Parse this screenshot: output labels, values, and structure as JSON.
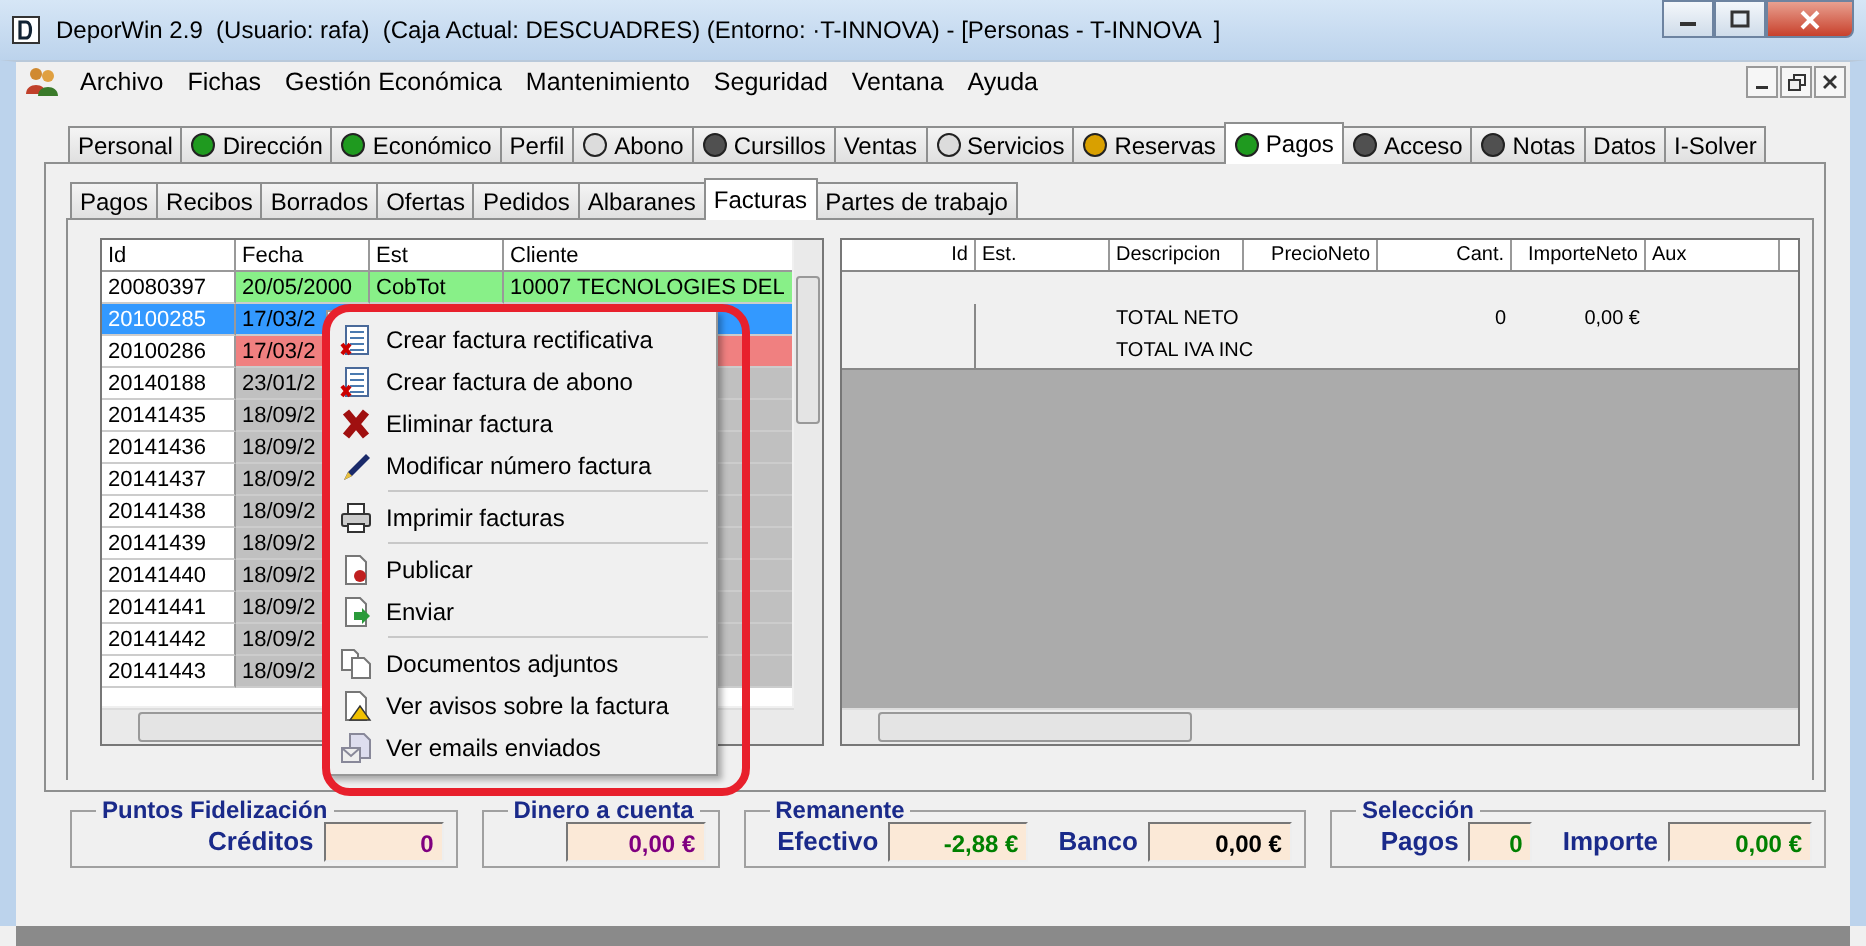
{
  "window": {
    "title": "DeporWin 2.9  (Usuario: rafa)  (Caja Actual: DESCUADRES) (Entorno: ·T-INNOVA) - [Personas - T-INNOVA  ]"
  },
  "menu_bar": [
    "Archivo",
    "Fichas",
    "Gestión Económica",
    "Mantenimiento",
    "Seguridad",
    "Ventana",
    "Ayuda"
  ],
  "main_tabs": [
    {
      "label": "Personal",
      "selected": false
    },
    {
      "label": "Dirección",
      "selected": false,
      "color": "#1f9a1f"
    },
    {
      "label": "Económico",
      "selected": false,
      "color": "#1f9a1f"
    },
    {
      "label": "Perfil",
      "selected": false
    },
    {
      "label": "Abono",
      "selected": false,
      "color": "#dcdcdc"
    },
    {
      "label": "Cursillos",
      "selected": false,
      "color": "#505050"
    },
    {
      "label": "Ventas",
      "selected": false
    },
    {
      "label": "Servicios",
      "selected": false,
      "color": "#dcdcdc"
    },
    {
      "label": "Reservas",
      "selected": false,
      "color": "#d9a000"
    },
    {
      "label": "Pagos",
      "selected": true,
      "color": "#1f9a1f"
    },
    {
      "label": "Acceso",
      "selected": false,
      "color": "#505050"
    },
    {
      "label": "Notas",
      "selected": false,
      "color": "#505050"
    },
    {
      "label": "Datos",
      "selected": false
    },
    {
      "label": "I-Solver",
      "selected": false
    }
  ],
  "sub_tabs": [
    {
      "label": "Pagos",
      "selected": false
    },
    {
      "label": "Recibos",
      "selected": false
    },
    {
      "label": "Borrados",
      "selected": false
    },
    {
      "label": "Ofertas",
      "selected": false
    },
    {
      "label": "Pedidos",
      "selected": false
    },
    {
      "label": "Albaranes",
      "selected": false
    },
    {
      "label": "Facturas",
      "selected": true
    },
    {
      "label": "Partes de trabajo",
      "selected": false
    }
  ],
  "invoices": {
    "columns": [
      "Id",
      "Fecha",
      "Est",
      "Cliente"
    ],
    "rows": [
      {
        "id": "20080397",
        "date": "20/05/2000",
        "status": "CobTot",
        "client": "10007 TECNOLOGIES DEL",
        "selected": false,
        "color": "#88f088"
      },
      {
        "id": "20100285",
        "date": "17/03/2",
        "selected": true,
        "color": "#3399ff"
      },
      {
        "id": "20100286",
        "date": "17/03/2",
        "selected": false,
        "color": "#f08080"
      },
      {
        "id": "20140188",
        "date": "23/01/2",
        "selected": false,
        "color": "#c0c0c0"
      },
      {
        "id": "20141435",
        "date": "18/09/2",
        "selected": false,
        "color": "#c0c0c0"
      },
      {
        "id": "20141436",
        "date": "18/09/2",
        "selected": false,
        "color": "#c0c0c0"
      },
      {
        "id": "20141437",
        "date": "18/09/2",
        "selected": false,
        "color": "#c0c0c0"
      },
      {
        "id": "20141438",
        "date": "18/09/2",
        "selected": false,
        "color": "#c0c0c0"
      },
      {
        "id": "20141439",
        "date": "18/09/2",
        "selected": false,
        "color": "#c0c0c0"
      },
      {
        "id": "20141440",
        "date": "18/09/2",
        "selected": false,
        "color": "#c0c0c0"
      },
      {
        "id": "20141441",
        "date": "18/09/2",
        "selected": false,
        "color": "#c0c0c0"
      },
      {
        "id": "20141442",
        "date": "18/09/2",
        "selected": false,
        "color": "#c0c0c0"
      },
      {
        "id": "20141443",
        "date": "18/09/2",
        "selected": false,
        "color": "#c0c0c0"
      }
    ]
  },
  "lines": {
    "columns": [
      "Id",
      "Est.",
      "Descripcion",
      "PrecioNeto",
      "Cant.",
      "ImporteNeto",
      "Aux"
    ],
    "rows": [
      {
        "description": "TOTAL NETO",
        "quantity": "0",
        "amount": "0,00 €"
      },
      {
        "description": "TOTAL IVA INC"
      }
    ]
  },
  "context_menu": [
    {
      "label": "Crear factura rectificativa",
      "separator_before": false
    },
    {
      "label": "Crear factura de abono",
      "separator_before": false
    },
    {
      "label": "Eliminar factura",
      "separator_before": false
    },
    {
      "label": "Modificar número factura",
      "separator_before": false
    },
    {
      "label": "Imprimir facturas",
      "separator_before": true
    },
    {
      "label": "Publicar",
      "separator_before": true
    },
    {
      "label": "Enviar",
      "separator_before": false
    },
    {
      "label": "Documentos adjuntos",
      "separator_before": true
    },
    {
      "label": "Ver avisos sobre la factura",
      "separator_before": false
    },
    {
      "label": "Ver emails enviados",
      "separator_before": false
    }
  ],
  "summary_groups": [
    {
      "title": "Puntos Fidelización",
      "fields": [
        {
          "label": "Créditos",
          "value": "0",
          "color": "#800080"
        }
      ]
    },
    {
      "title": "Dinero a cuenta",
      "fields": [
        {
          "value": "0,00 €",
          "color": "#800080"
        }
      ]
    },
    {
      "title": "Remanente",
      "fields": [
        {
          "label": "Efectivo",
          "value": "-2,88 €",
          "color": "#008000"
        },
        {
          "label": "Banco",
          "value": "0,00 €",
          "color": "#000000"
        }
      ]
    },
    {
      "title": "Selección",
      "fields": [
        {
          "label": "Pagos",
          "value": "0",
          "color": "#008000"
        },
        {
          "label": "Importe",
          "value": "0,00 €",
          "color": "#008000"
        }
      ]
    }
  ]
}
